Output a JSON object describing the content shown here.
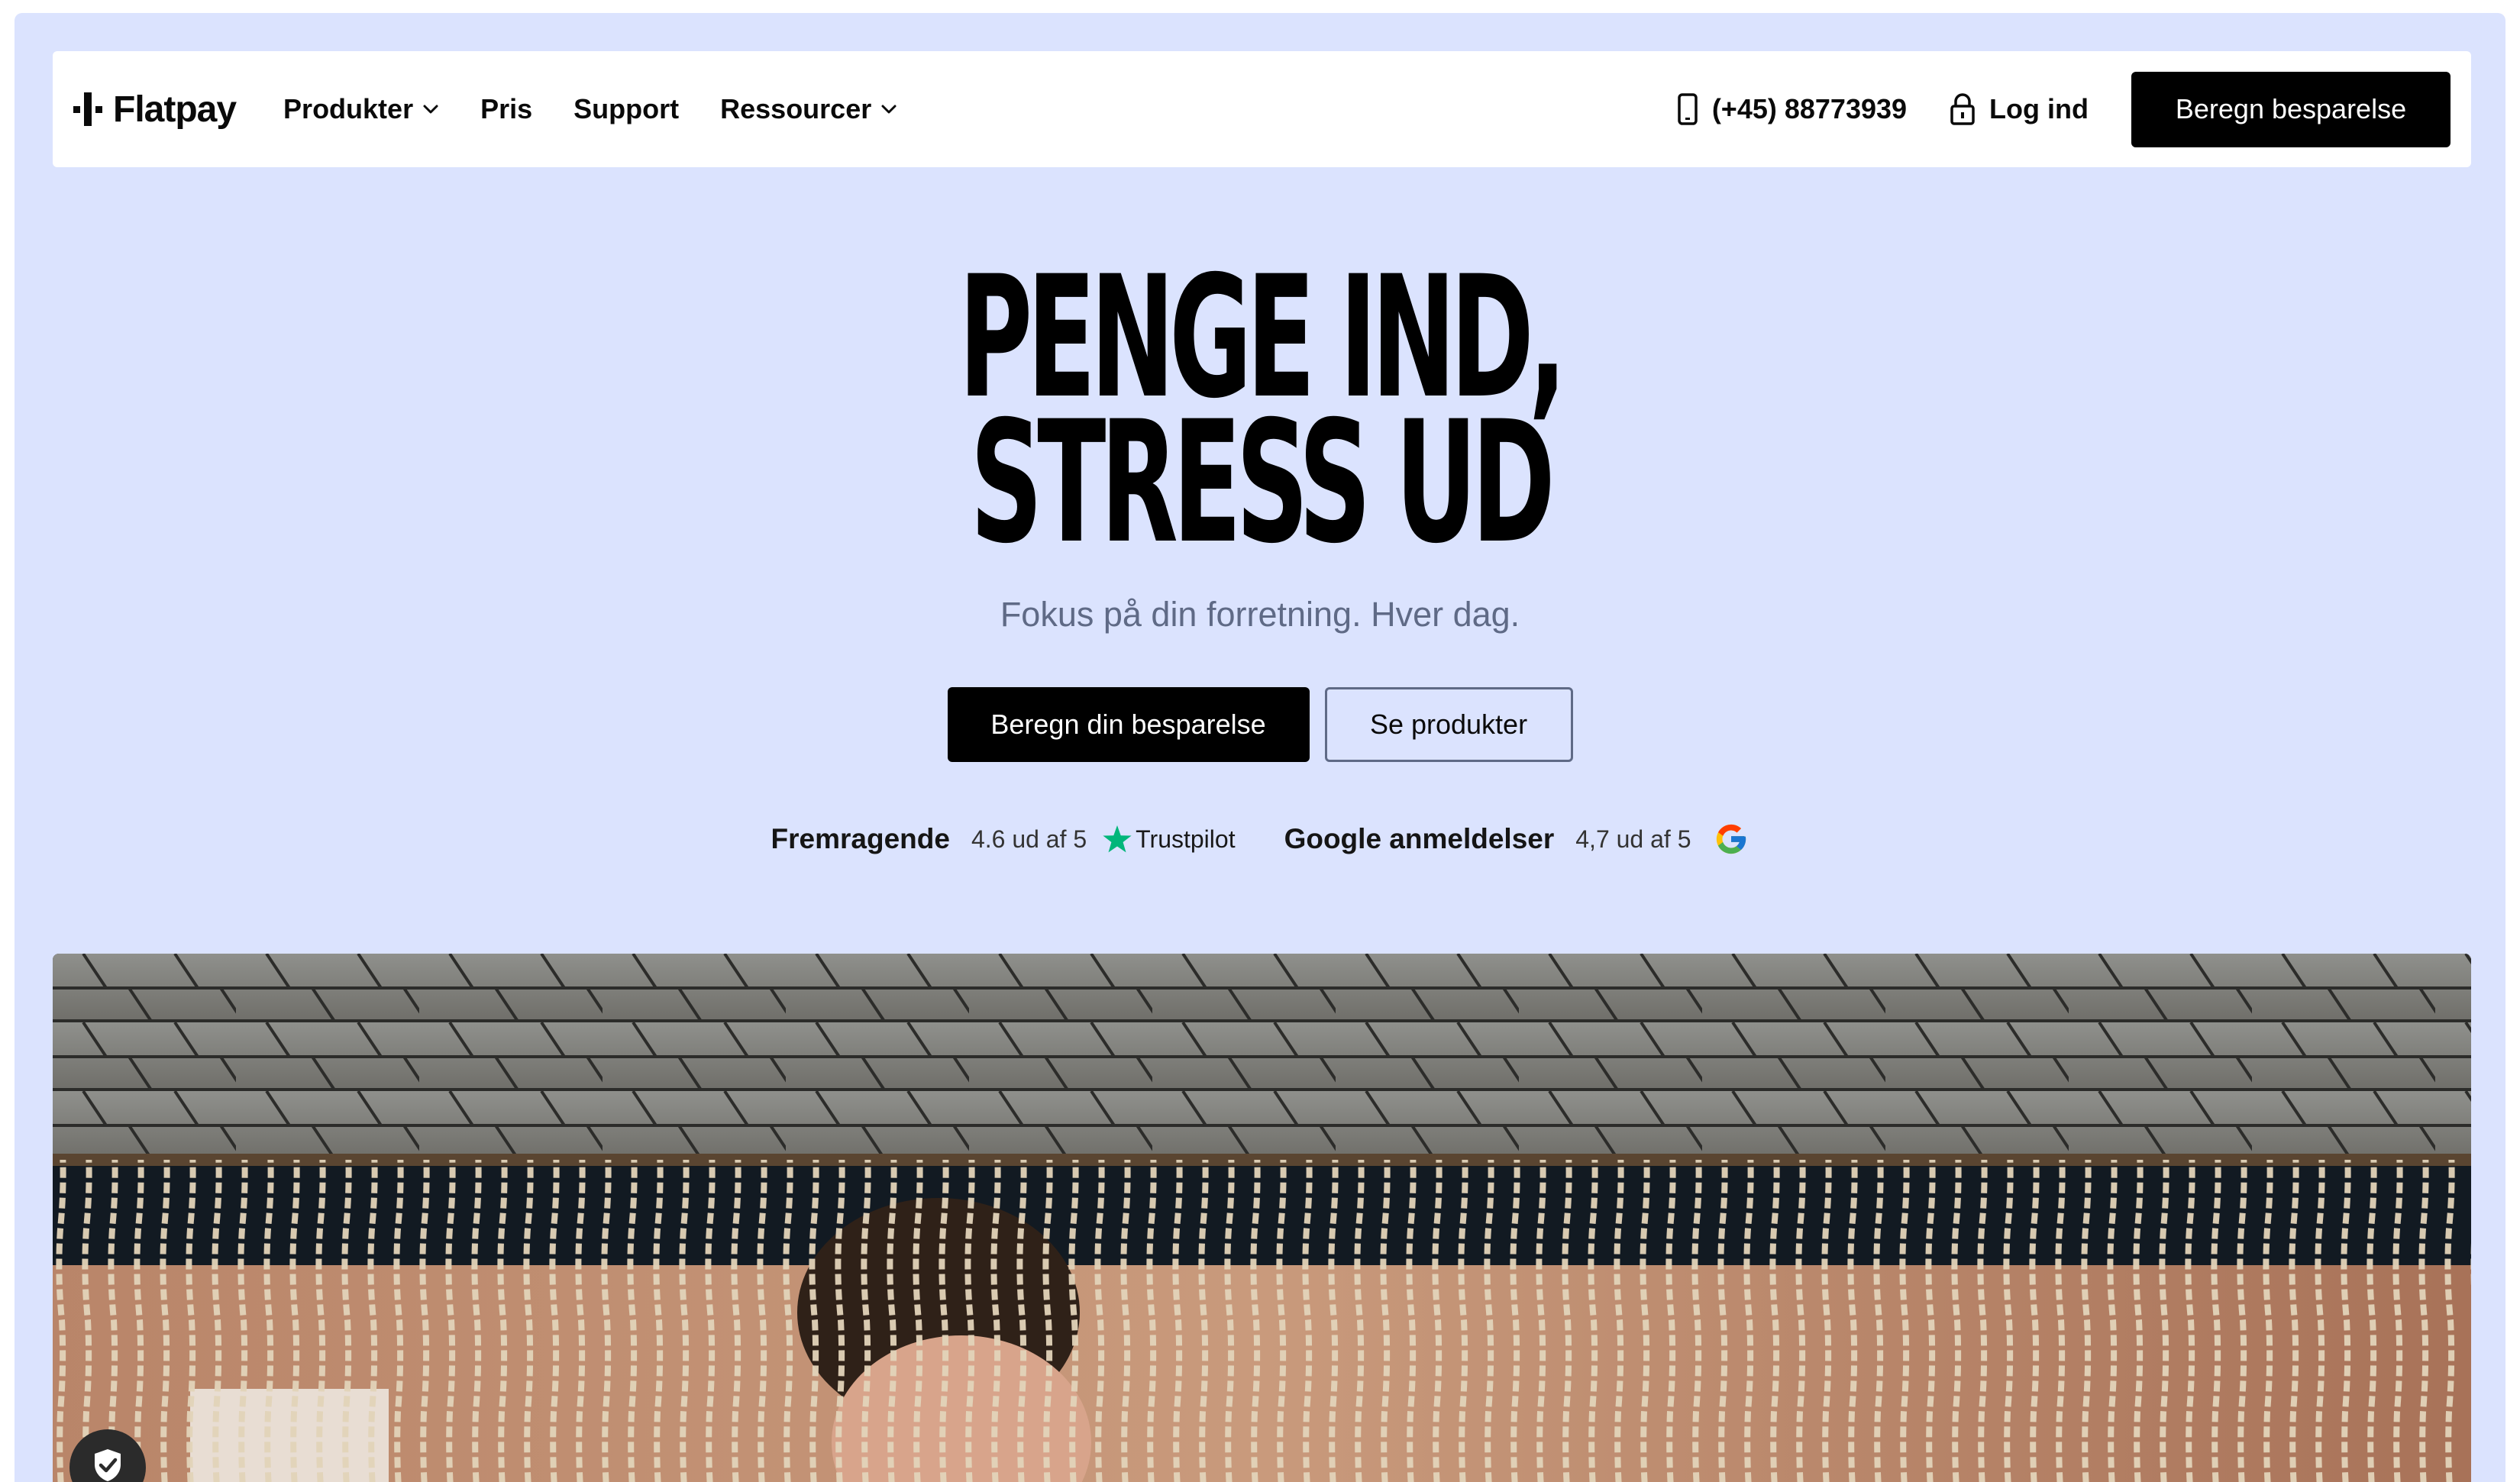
{
  "brand": {
    "name": "Flatpay"
  },
  "nav": {
    "items": [
      {
        "label": "Produkter",
        "has_dropdown": true
      },
      {
        "label": "Pris",
        "has_dropdown": false
      },
      {
        "label": "Support",
        "has_dropdown": false
      },
      {
        "label": "Ressourcer",
        "has_dropdown": true
      }
    ],
    "phone": "(+45) 88773939",
    "login": "Log ind",
    "cta": "Beregn besparelse"
  },
  "hero": {
    "title_line1": "PENGE IND,",
    "title_line2": "STRESS UD",
    "subtitle": "Fokus på din forretning. Hver dag.",
    "primary_cta": "Beregn din besparelse",
    "secondary_cta": "Se produkter"
  },
  "ratings": {
    "trustpilot": {
      "label": "Fremragende",
      "score": "4.6 ud af 5",
      "brand": "Trustpilot"
    },
    "google": {
      "label": "Google anmeldelser",
      "score": "4,7 ud af 5"
    }
  },
  "icons": {
    "logo": "flatpay-logo-icon",
    "dropdown": "chevron-down-icon",
    "phone": "phone-icon",
    "login": "lock-icon",
    "trustpilot": "trustpilot-star-icon",
    "google": "google-g-icon",
    "privacy": "shield-check-icon"
  },
  "colors": {
    "page_bg": "#dbe3fe",
    "accent": "#000000",
    "subtitle": "#5f6a86",
    "trustpilot_green": "#00b67a"
  }
}
